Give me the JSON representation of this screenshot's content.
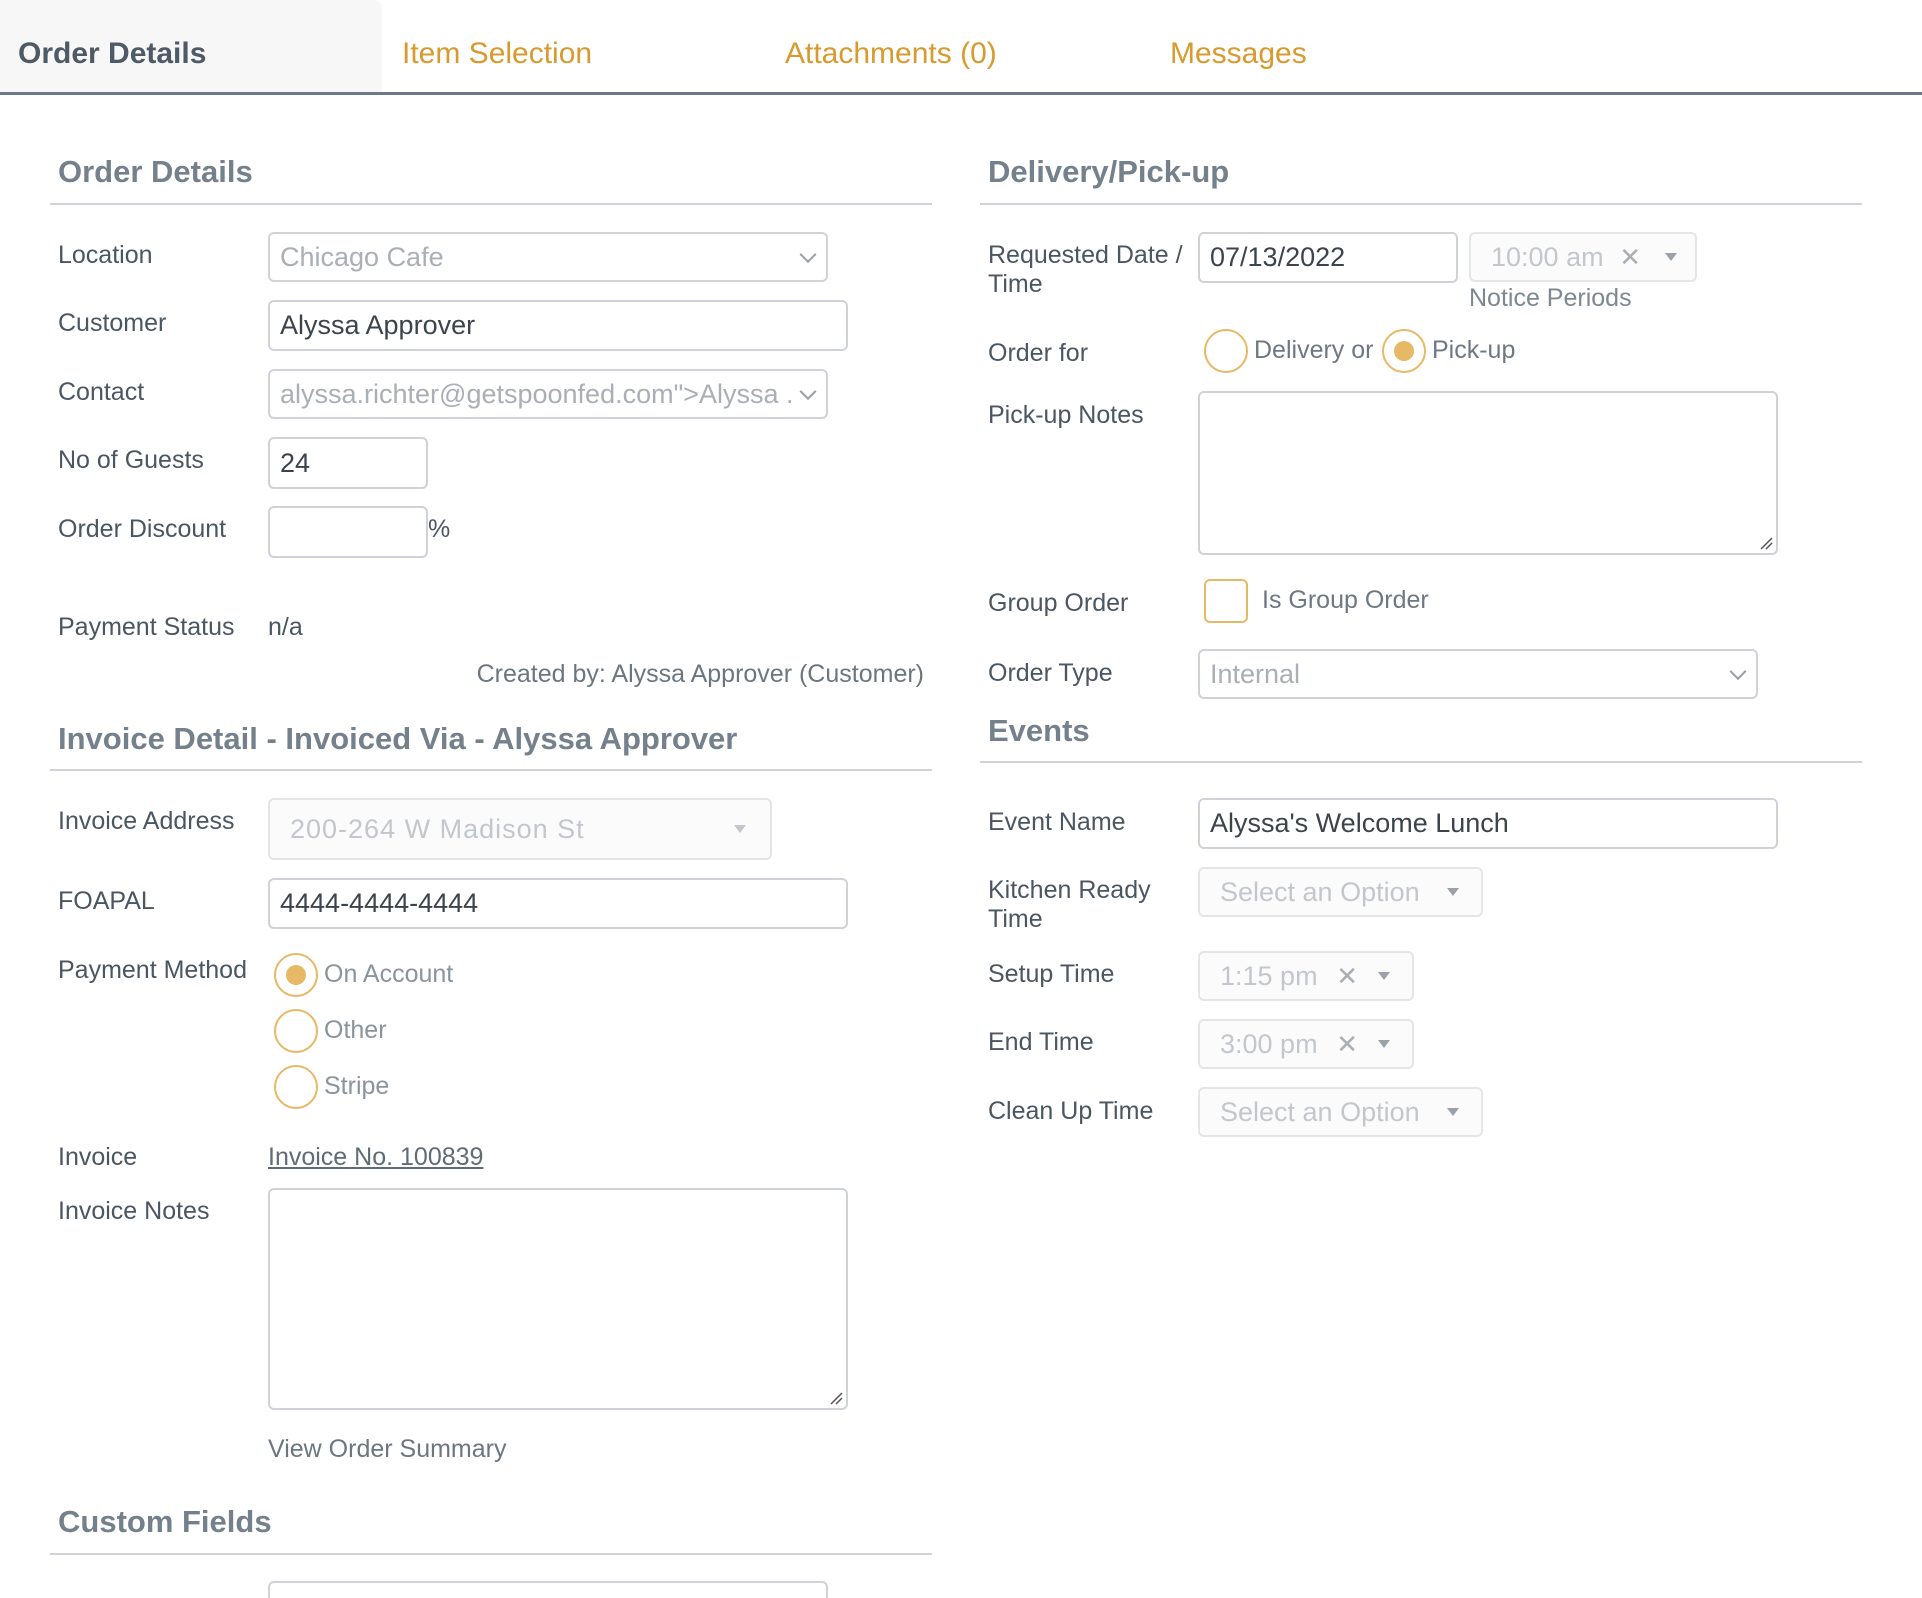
{
  "tabs": [
    {
      "label": "Order Details"
    },
    {
      "label": "Item Selection"
    },
    {
      "label": "Attachments (0)"
    },
    {
      "label": "Messages"
    }
  ],
  "order_details": {
    "title": "Order Details",
    "location_label": "Location",
    "location_value": "Chicago Cafe",
    "customer_label": "Customer",
    "customer_value": "Alyssa Approver",
    "contact_label": "Contact",
    "contact_value": "alyssa.richter@getspoonfed.com\">Alyssa .",
    "guests_label": "No of Guests",
    "guests_value": "24",
    "discount_label": "Order Discount",
    "discount_value": "",
    "discount_unit": "%",
    "payment_status_label": "Payment Status",
    "payment_status_value": "n/a",
    "created_by": "Created by: Alyssa Approver (Customer)"
  },
  "invoice": {
    "title": "Invoice Detail - Invoiced Via - Alyssa Approver",
    "address_label": "Invoice Address",
    "address_value": "200-264 W Madison St",
    "foapal_label": "FOAPAL",
    "foapal_value": "4444-4444-4444",
    "payment_method_label": "Payment Method",
    "payment_options": [
      {
        "label": "On Account",
        "selected": true
      },
      {
        "label": "Other",
        "selected": false
      },
      {
        "label": "Stripe",
        "selected": false
      }
    ],
    "invoice_label": "Invoice",
    "invoice_link": "Invoice No. 100839",
    "notes_label": "Invoice Notes",
    "notes_value": "",
    "summary_link": "View Order Summary"
  },
  "custom_fields": {
    "title": "Custom Fields"
  },
  "delivery": {
    "title": "Delivery/Pick-up",
    "date_label_1": "Requested Date /",
    "date_label_2": "Time",
    "date_value": "07/13/2022",
    "time_value": "10:00 am",
    "notice_link": "Notice Periods",
    "order_for_label": "Order for",
    "order_for_options": [
      {
        "label": "Delivery or",
        "selected": false
      },
      {
        "label": "Pick-up",
        "selected": true
      }
    ],
    "pickup_notes_label": "Pick-up Notes",
    "pickup_notes_value": "",
    "group_order_label": "Group Order",
    "group_order_checkbox_label": "Is Group Order",
    "group_order_checked": false,
    "order_type_label": "Order Type",
    "order_type_value": "Internal"
  },
  "events": {
    "title": "Events",
    "event_name_label": "Event Name",
    "event_name_value": "Alyssa's Welcome Lunch",
    "kitchen_label_1": "Kitchen Ready",
    "kitchen_label_2": "Time",
    "kitchen_value": "Select an Option",
    "setup_label": "Setup Time",
    "setup_value": "1:15 pm",
    "end_label": "End Time",
    "end_value": "3:00 pm",
    "cleanup_label": "Clean Up Time",
    "cleanup_value": "Select an Option"
  },
  "colors": {
    "accent": "#d89a2e",
    "radio": "#e7b866",
    "heading": "#74808b",
    "tab_border": "#6d7a86"
  }
}
